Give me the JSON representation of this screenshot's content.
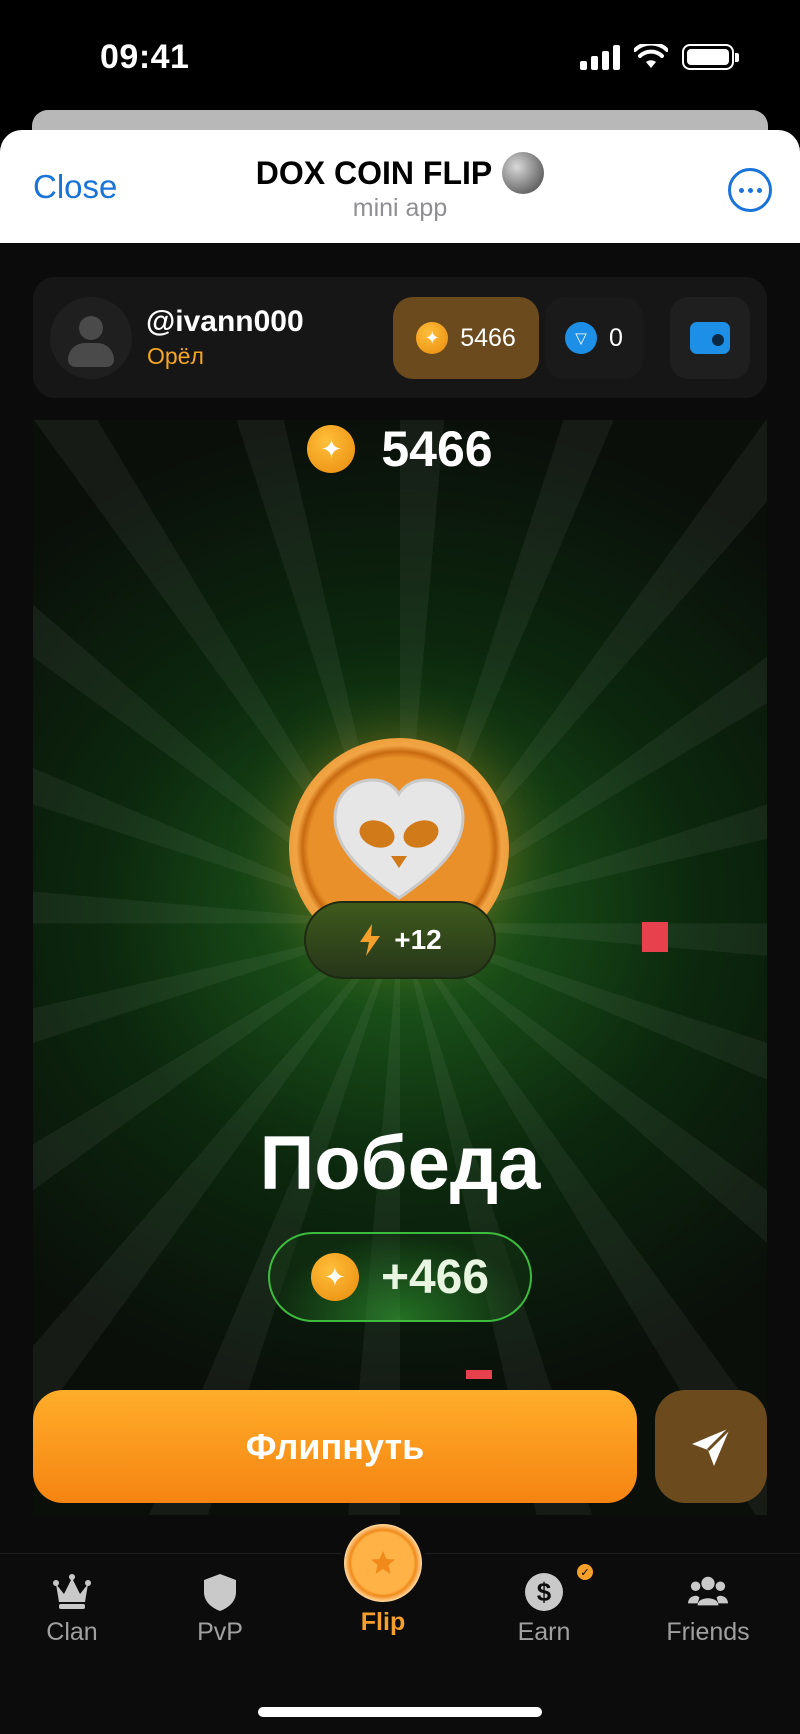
{
  "status_bar": {
    "time": "09:41"
  },
  "header": {
    "close_label": "Close",
    "title": "DOX COIN FLIP",
    "subtitle": "mini app"
  },
  "user": {
    "username": "@ivann000",
    "side": "Орёл",
    "coin_balance": "5466",
    "ton_balance": "0"
  },
  "game": {
    "balance": "5466",
    "bonus": "+12",
    "result_title": "Победа",
    "win_amount": "+466",
    "flip_button": "Флипнуть"
  },
  "nav": {
    "items": [
      {
        "label": "Clan",
        "icon": "crown-icon"
      },
      {
        "label": "PvP",
        "icon": "shield-icon"
      },
      {
        "label": "Flip",
        "icon": "star-icon"
      },
      {
        "label": "Earn",
        "icon": "dollar-icon"
      },
      {
        "label": "Friends",
        "icon": "friends-icon"
      }
    ]
  },
  "colors": {
    "accent_orange": "#f58411",
    "link_blue": "#1a73d9",
    "win_green": "#3dbb3d"
  }
}
